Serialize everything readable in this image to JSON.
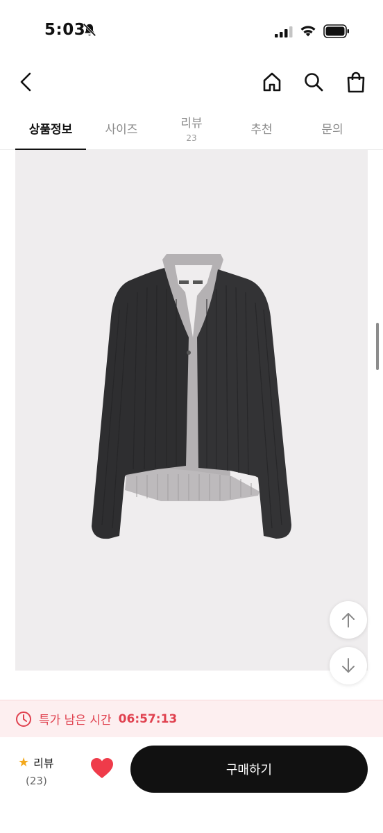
{
  "status_bar": {
    "time": "5:03",
    "icons": [
      "bell-slash-icon",
      "signal-icon",
      "wifi-icon",
      "battery-icon"
    ]
  },
  "nav": {
    "back_icon": "chevron-left-icon",
    "home_icon": "home-icon",
    "search_icon": "search-icon",
    "bag_icon": "shopping-bag-icon"
  },
  "tabs": [
    {
      "label": "상품정보",
      "count": "",
      "active": true
    },
    {
      "label": "사이즈",
      "count": "",
      "active": false
    },
    {
      "label": "리뷰",
      "count": "23",
      "active": false
    },
    {
      "label": "추천",
      "count": "",
      "active": false
    },
    {
      "label": "문의",
      "count": "",
      "active": false
    }
  ],
  "product_image": {
    "subject": "dark charcoal ribbed cardigan with grey halter layer",
    "colors": {
      "cardigan": "#2e2e30",
      "inner": "#b4b1b3",
      "background": "#efedee"
    }
  },
  "floating_buttons": {
    "up_icon": "arrow-up-icon",
    "down_icon": "arrow-down-icon"
  },
  "timer": {
    "icon": "clock-icon",
    "label": "특가 남은 시간",
    "value": "06:57:13",
    "color": "#e0414f"
  },
  "bottom_bar": {
    "review_label": "리뷰",
    "review_count": "(23)",
    "star_icon": "star-icon",
    "like_icon": "heart-icon",
    "like_color": "#ef3b4a",
    "buy_label": "구매하기"
  }
}
